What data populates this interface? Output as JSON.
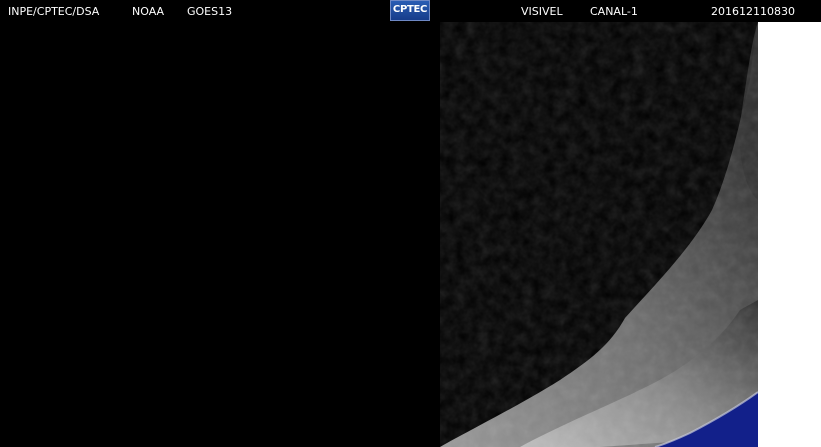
{
  "header": {
    "institution": "INPE/CPTEC/DSA",
    "agency": "NOAA",
    "satellite": "GOES13",
    "logo_text": "CPTEC",
    "band": "VISIVEL",
    "channel": "CANAL-1",
    "timestamp": "201612110830"
  },
  "colors": {
    "background": "#000000",
    "header_text": "#ffffff",
    "logo_blue": "#2a5db4",
    "ocean_blue": "#12208a",
    "strip": "#ffffff"
  }
}
